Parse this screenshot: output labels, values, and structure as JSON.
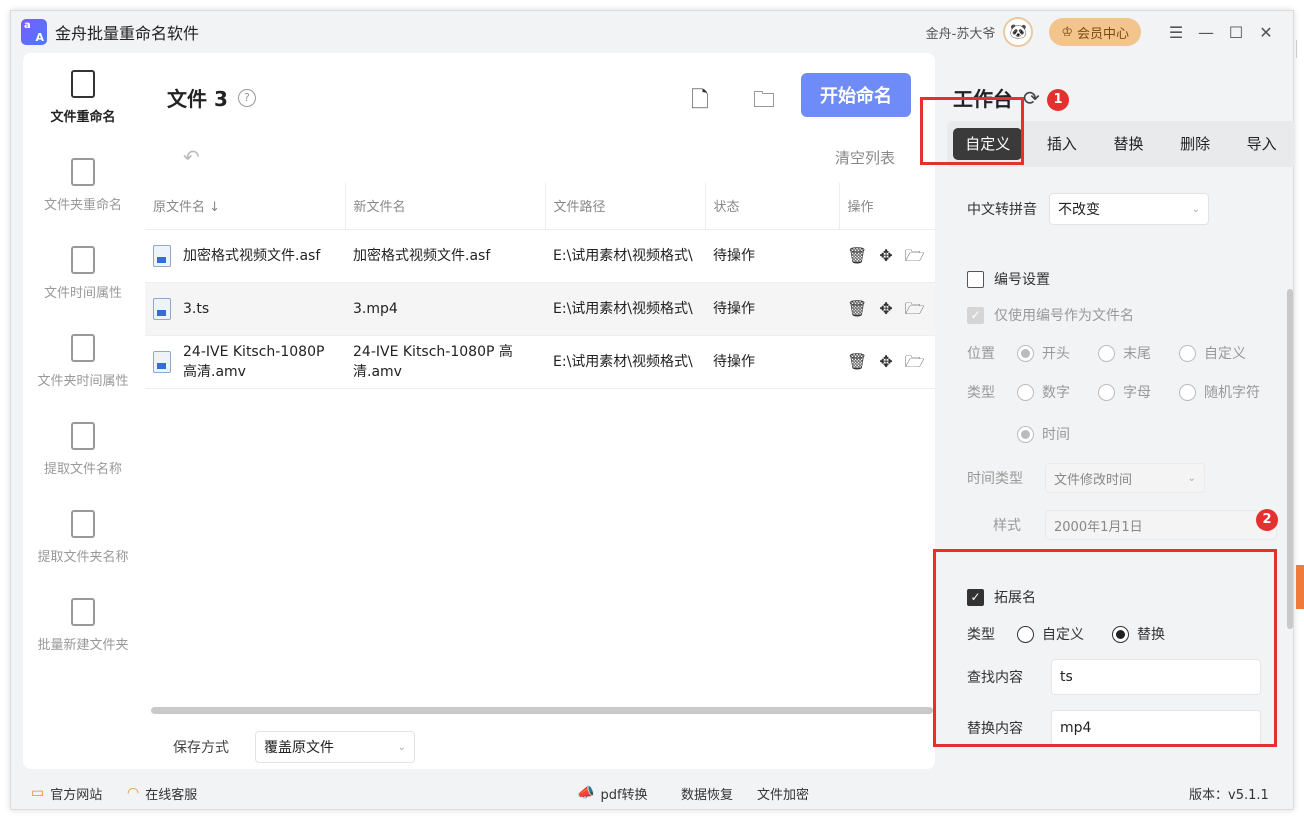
{
  "app": {
    "title": "金舟批量重命名软件",
    "logo_a1": "a",
    "logo_a2": "A"
  },
  "titlebar": {
    "user": "金舟-苏大爷",
    "vip_label": "会员中心",
    "minimize": "—",
    "maximize": "☐",
    "close": "✕",
    "menu": "☰"
  },
  "sidebar": {
    "items": [
      {
        "label": "文件重命名"
      },
      {
        "label": "文件夹重命名"
      },
      {
        "label": "文件时间属性"
      },
      {
        "label": "文件夹时间属性"
      },
      {
        "label": "提取文件名称"
      },
      {
        "label": "提取文件夹名称"
      },
      {
        "label": "批量新建文件夹"
      }
    ]
  },
  "main": {
    "title": "文件 3",
    "help": "?",
    "start_label": "开始命名",
    "clear_label": "清空列表",
    "columns": [
      "原文件名 ↓",
      "新文件名",
      "文件路径",
      "状态",
      "操作"
    ],
    "rows": [
      {
        "orig": "加密格式视频文件.asf",
        "new": "加密格式视频文件.asf",
        "path": "E:\\试用素材\\视频格式\\",
        "status": "待操作"
      },
      {
        "orig": "3.ts",
        "new": "3.mp4",
        "path": "E:\\试用素材\\视频格式\\",
        "status": "待操作"
      },
      {
        "orig": "24-IVE Kitsch-1080P 高清.amv",
        "new": "24-IVE Kitsch-1080P 高清.amv",
        "path": "E:\\试用素材\\视频格式\\",
        "status": "待操作"
      }
    ],
    "save_label": "保存方式",
    "save_value": "覆盖原文件"
  },
  "panel": {
    "title": "工作台",
    "tabs": [
      "自定义",
      "插入",
      "替换",
      "删除",
      "导入"
    ],
    "pinyin_label": "中文转拼音",
    "pinyin_value": "不改变",
    "numbering_label": "编号设置",
    "only_number_label": "仅使用编号作为文件名",
    "position_label": "位置",
    "position_opts": [
      "开头",
      "末尾",
      "自定义"
    ],
    "type_label": "类型",
    "type_opts": [
      "数字",
      "字母",
      "随机字符"
    ],
    "type_time": "时间",
    "time_type_label": "时间类型",
    "time_type_value": "文件修改时间",
    "style_label": "样式",
    "style_value": "2000年1月1日",
    "ext_label": "拓展名",
    "ext_type_label": "类型",
    "ext_type_opts": [
      "自定义",
      "替换"
    ],
    "find_label": "查找内容",
    "find_value": "ts",
    "replace_label": "替换内容",
    "replace_value": "mp4"
  },
  "badges": [
    "1",
    "2"
  ],
  "statusbar": {
    "website": "官方网站",
    "support": "在线客服",
    "pdf": "pdf转换",
    "recover": "数据恢复",
    "encrypt": "文件加密",
    "version": "版本：v5.1.1"
  },
  "colors": {
    "accent": "#6e8bf7",
    "highlight": "#e53030",
    "vip": "#f3c48c"
  }
}
